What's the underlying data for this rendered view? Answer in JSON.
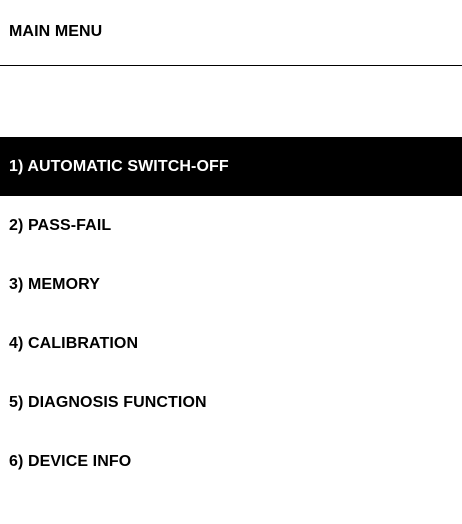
{
  "header": {
    "title": "MAIN MENU"
  },
  "menu": {
    "selected_index": 0,
    "items": [
      {
        "label": "1) AUTOMATIC SWITCH-OFF"
      },
      {
        "label": "2) PASS-FAIL"
      },
      {
        "label": "3) MEMORY"
      },
      {
        "label": "4) CALIBRATION"
      },
      {
        "label": "5) DIAGNOSIS FUNCTION"
      },
      {
        "label": "6) DEVICE INFO"
      }
    ]
  },
  "colors": {
    "background": "#ffffff",
    "text": "#000000",
    "selected_background": "#000000",
    "selected_text": "#ffffff"
  }
}
